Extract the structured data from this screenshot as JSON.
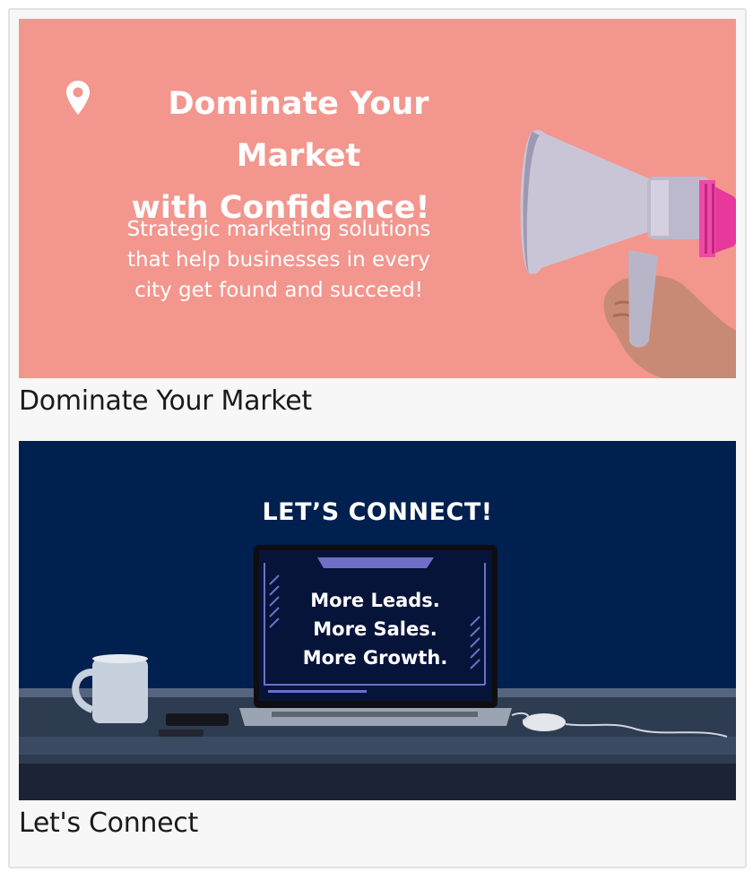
{
  "cards": [
    {
      "banner": {
        "headline_line1": "Dominate Your Market",
        "headline_line2": "with Confidence!",
        "subtext_line1": "Strategic marketing solutions",
        "subtext_line2": "that help businesses in every",
        "subtext_line3": "city get found and succeed!",
        "background": "#f3968e",
        "icon": "location-pin-icon"
      },
      "caption": "Dominate Your Market"
    },
    {
      "banner": {
        "title": "LET’S CONNECT!",
        "screen_line1": "More Leads.",
        "screen_line2": "More Sales.",
        "screen_line3": "More Growth.",
        "background": "#00204f"
      },
      "caption": "Let's Connect"
    }
  ]
}
